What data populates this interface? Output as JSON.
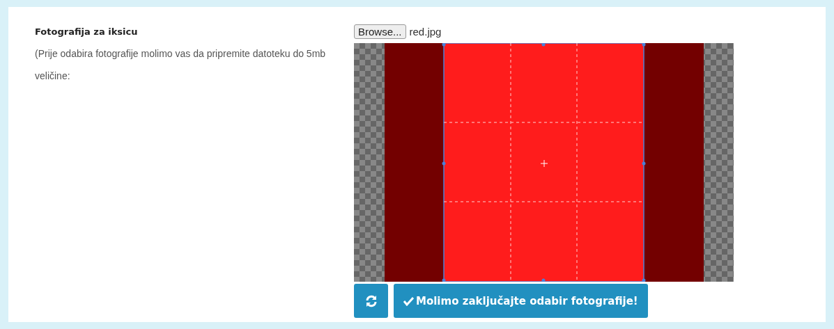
{
  "field": {
    "title": "Fotografija za iksicu",
    "description": "(Prije odabira fotografije molimo vas da pripremite datoteku do 5mb veličine:"
  },
  "file_input": {
    "button": "Browse...",
    "filename": "red.jpg"
  },
  "buttons": [
    {
      "kind": "reset"
    },
    {
      "kind": "confirm",
      "label": "Molimo zaključajte odabir fotografije!"
    }
  ]
}
